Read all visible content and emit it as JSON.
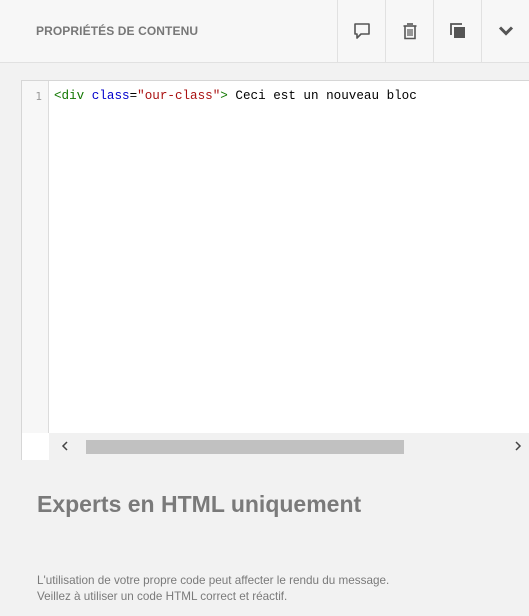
{
  "header": {
    "title": "PROPRIÉTÉS DE CONTENU",
    "tools": [
      {
        "name": "comment-button",
        "icon": "speech-bubble-icon"
      },
      {
        "name": "delete-button",
        "icon": "trash-icon"
      },
      {
        "name": "duplicate-button",
        "icon": "copy-icon"
      },
      {
        "name": "collapse-button",
        "icon": "chevron-down-icon"
      }
    ]
  },
  "editor": {
    "line_number": "1",
    "code": {
      "open": "<div",
      "attr": "class",
      "eq": "=",
      "value": "\"our-class\"",
      "close": ">",
      "text": " Ceci est un nouveau bloc"
    },
    "scroll_left": "<",
    "scroll_right": ">"
  },
  "info": {
    "title": "Experts en HTML uniquement",
    "line1": "L'utilisation de votre propre code peut affecter le rendu du message.",
    "line2": "Veillez à utiliser un code HTML correct et réactif."
  },
  "colors": {
    "icon": "#555555",
    "tag": "#117700",
    "attribute": "#0000cc",
    "string": "#aa1111"
  }
}
